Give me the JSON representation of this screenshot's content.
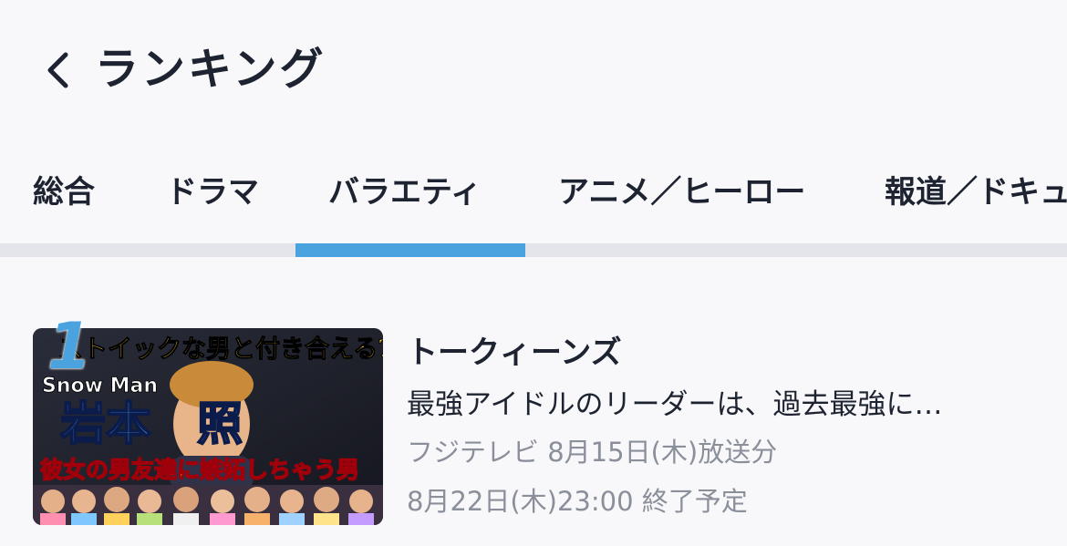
{
  "header": {
    "back_icon": "chevron-left-icon",
    "title": "ランキング"
  },
  "tabs": [
    {
      "label": "総合",
      "selected": false
    },
    {
      "label": "ドラマ",
      "selected": false
    },
    {
      "label": "バラエティ",
      "selected": true
    },
    {
      "label": "アニメ／ヒーロー",
      "selected": false
    },
    {
      "label": "報道／ドキュ",
      "selected": false
    }
  ],
  "accent_color": "#4aa3df",
  "items": [
    {
      "rank": "1",
      "thumbnail": {
        "headline": "ストイックな男と付き合える?",
        "group": "Snow Man",
        "name": "岩本　照",
        "caption": "彼女の男友達に嫉妬しちゃう男"
      },
      "title": "トークィーンズ",
      "description": "最強アイドルのリーダーは、過去最強に…",
      "meta": "フジテレビ 8月15日(木)放送分",
      "end": "8月22日(木)23:00 終了予定"
    }
  ]
}
